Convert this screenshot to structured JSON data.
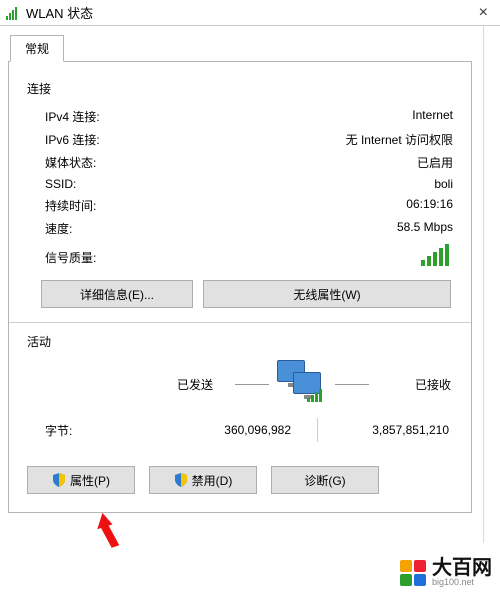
{
  "title": "WLAN 状态",
  "tab_label": "常规",
  "connection": {
    "section": "连接",
    "ipv4_label": "IPv4 连接:",
    "ipv4_value": "Internet",
    "ipv6_label": "IPv6 连接:",
    "ipv6_value": "无 Internet 访问权限",
    "media_label": "媒体状态:",
    "media_value": "已启用",
    "ssid_label": "SSID:",
    "ssid_value": "boli",
    "duration_label": "持续时间:",
    "duration_value": "06:19:16",
    "speed_label": "速度:",
    "speed_value": "58.5 Mbps",
    "signal_label": "信号质量:"
  },
  "buttons": {
    "details": "详细信息(E)...",
    "wireless": "无线属性(W)",
    "properties": "属性(P)",
    "disable": "禁用(D)",
    "diagnose": "诊断(G)"
  },
  "activity": {
    "section": "活动",
    "sent_label": "已发送",
    "recv_label": "已接收",
    "bytes_label": "字节:",
    "bytes_sent": "360,096,982",
    "bytes_recv": "3,857,851,210"
  },
  "watermark": {
    "name": "大百网",
    "url": "big100.net"
  }
}
